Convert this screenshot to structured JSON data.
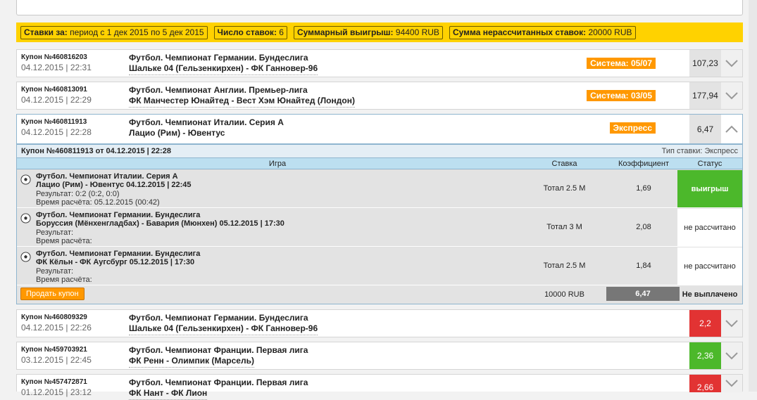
{
  "summary": {
    "period_label": "Ставки за:",
    "period_value": "период с 1 дек 2015 по 5 дек 2015",
    "count_label": "Число ставок:",
    "count_value": "6",
    "win_label": "Суммарный выигрыш:",
    "win_value": "94400 RUB",
    "unsettled_label": "Сумма нерассчитанных ставок:",
    "unsettled_value": "20000 RUB"
  },
  "coupons": [
    {
      "num": "Купон №460816203",
      "date": "04.12.2015 | 22:31",
      "league": "Футбол. Чемпионат Германии. Бундеслига",
      "match": "Шальке 04 (Гельзенкирхен) - ФК Ганновер-96",
      "badge": "Система: 05/07",
      "coef": "107,23"
    },
    {
      "num": "Купон №460813091",
      "date": "04.12.2015 | 22:29",
      "league": "Футбол. Чемпионат Англии. Премьер-лига",
      "match": "ФК Манчестер Юнайтед - Вест Хэм Юнайтед (Лондон)",
      "badge": "Система: 03/05",
      "coef": "177,94"
    },
    {
      "num": "Купон №460811913",
      "date": "04.12.2015 | 22:28",
      "league": "Футбол. Чемпионат Италии. Серия А",
      "match": "Лацио (Рим) - Ювентус",
      "badge": "Экспресс",
      "coef": "6,47"
    },
    {
      "num": "Купон №460809329",
      "date": "04.12.2015 | 22:26",
      "league": "Футбол. Чемпионат Германии. Бундеслига",
      "match": "Шальке 04 (Гельзенкирхен) - ФК Ганновер-96",
      "coef": "2,2"
    },
    {
      "num": "Купон №459703921",
      "date": "03.12.2015 | 22:45",
      "league": "Футбол. Чемпионат Франции. Первая лига",
      "match": "ФК Ренн - Олимпик (Марсель)",
      "coef": "2,36"
    },
    {
      "num": "Купон №457472871",
      "date": "01.12.2015 | 23:12",
      "league": "Футбол. Чемпионат Франции. Первая лига",
      "match": "ФК Нант - ФК Лион",
      "coef": "2,66"
    }
  ],
  "details": {
    "title": "Купон №460811913 от 04.12.2015 | 22:28",
    "bet_type": "Тип ставки: Экспресс",
    "headers": {
      "game": "Игра",
      "stake": "Ставка",
      "coef": "Коэффициент",
      "status": "Статус"
    },
    "rows": [
      {
        "league": "Футбол. Чемпионат Италии. Серия А",
        "match": "Лацио (Рим) - Ювентус 04.12.2015 | 22:45",
        "result": "Результат: 0:2 (0:2, 0:0)",
        "calc_time": "Время расчёта: 05.12.2015 (00:42)",
        "stake": "Тотал 2.5 М",
        "coef": "1,69",
        "status": "выигрыш"
      },
      {
        "league": "Футбол. Чемпионат Германии. Бундеслига",
        "match": "Боруссия (Мёнхенгладбах) - Бавария (Мюнхен) 05.12.2015 | 17:30",
        "result": "Результат:",
        "calc_time": "Время расчёта:",
        "stake": "Тотал 3 М",
        "coef": "2,08",
        "status": "не рассчитано"
      },
      {
        "league": "Футбол. Чемпионат Германии. Бундеслига",
        "match": "ФК Кёльн - ФК Аугсбург 05.12.2015 | 17:30",
        "result": "Результат:",
        "calc_time": "Время расчёта:",
        "stake": "Тотал 2.5 М",
        "coef": "1,84",
        "status": "не рассчитано"
      }
    ],
    "footer": {
      "sell_label": "Продать купон",
      "stake": "10000 RUB",
      "coef": "6,47",
      "status": "Не выплачено"
    }
  },
  "colors": {
    "accent_yellow": "#ffd200",
    "badge_orange": "#ff9800",
    "win_green": "#4cb82b",
    "loss_red": "#e23333"
  }
}
